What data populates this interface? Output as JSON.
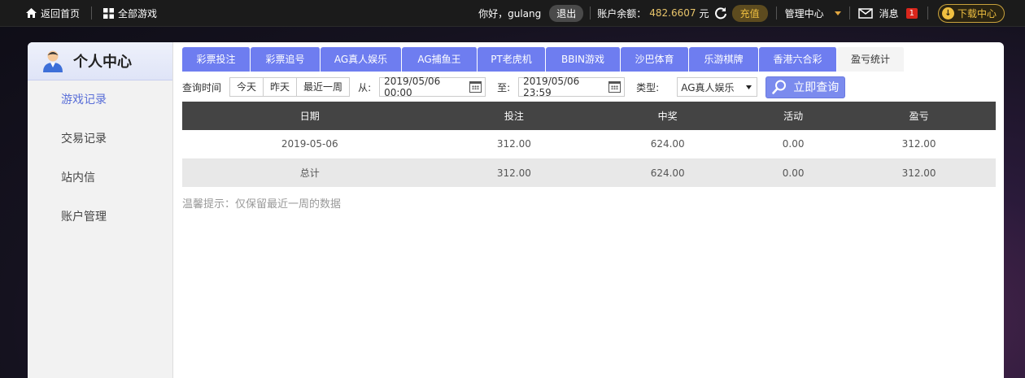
{
  "topbar": {
    "home": "返回首页",
    "all_games": "全部游戏",
    "greeting": "你好，gulang",
    "logout": "退出",
    "balance_label": "账户余额：",
    "balance_value": "482.6607",
    "balance_unit": "元",
    "recharge": "充值",
    "manage": "管理中心",
    "messages": "消息",
    "message_count": "1",
    "download": "下载中心"
  },
  "sidebar": {
    "title": "个人中心",
    "items": [
      {
        "label": "游戏记录"
      },
      {
        "label": "交易记录"
      },
      {
        "label": "站内信"
      },
      {
        "label": "账户管理"
      }
    ]
  },
  "tabs": [
    {
      "label": "彩票投注"
    },
    {
      "label": "彩票追号"
    },
    {
      "label": "AG真人娱乐"
    },
    {
      "label": "AG捕鱼王"
    },
    {
      "label": "PT老虎机"
    },
    {
      "label": "BBIN游戏"
    },
    {
      "label": "沙巴体育"
    },
    {
      "label": "乐游棋牌"
    },
    {
      "label": "香港六合彩"
    },
    {
      "label": "盈亏统计"
    }
  ],
  "filter": {
    "query_time_label": "查询时间",
    "quick": [
      "今天",
      "昨天",
      "最近一周"
    ],
    "from_label": "从:",
    "from_value": "2019/05/06 00:00",
    "to_label": "至:",
    "to_value": "2019/05/06 23:59",
    "type_label": "类型:",
    "type_value": "AG真人娱乐",
    "query_button": "立即查询"
  },
  "table": {
    "headers": [
      "日期",
      "投注",
      "中奖",
      "活动",
      "盈亏"
    ],
    "rows": [
      [
        "2019-05-06",
        "312.00",
        "624.00",
        "0.00",
        "312.00"
      ]
    ],
    "total": [
      "总计",
      "312.00",
      "624.00",
      "0.00",
      "312.00"
    ]
  },
  "tip": "温馨提示：仅保留最近一周的数据"
}
